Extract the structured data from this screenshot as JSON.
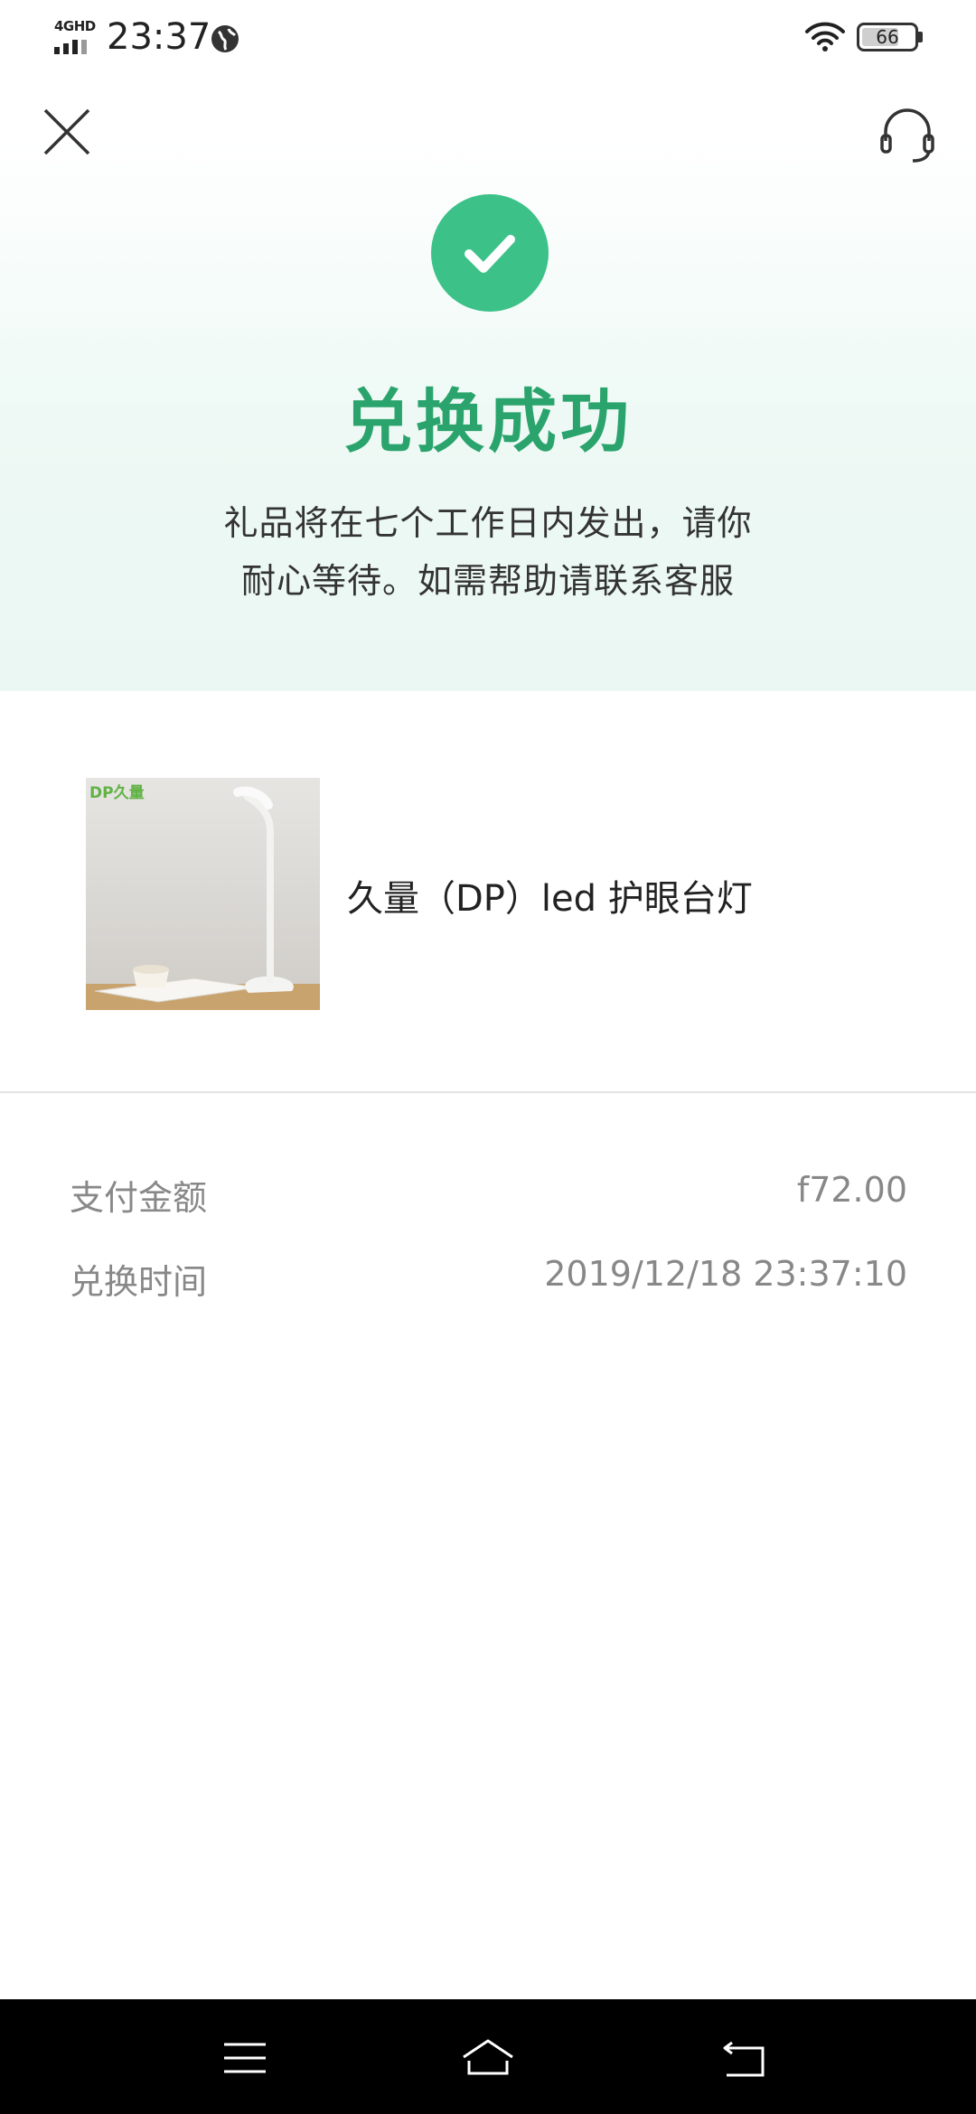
{
  "status_bar": {
    "network": "4GHD",
    "time": "23:37",
    "battery": "66"
  },
  "success": {
    "title": "兑换成功",
    "desc_line1": "礼品将在七个工作日内发出，请你",
    "desc_line2": "耐心等待。如需帮助请联系客服"
  },
  "product": {
    "image_brand": "DP久量",
    "name": "久量（DP）led 护眼台灯"
  },
  "details": {
    "rows": [
      {
        "label": "支付金额",
        "value": "f72.00"
      },
      {
        "label": "兑换时间",
        "value": "2019/12/18 23:37:10"
      }
    ]
  },
  "colors": {
    "accent": "#3cc288",
    "title": "#2aa46c"
  }
}
